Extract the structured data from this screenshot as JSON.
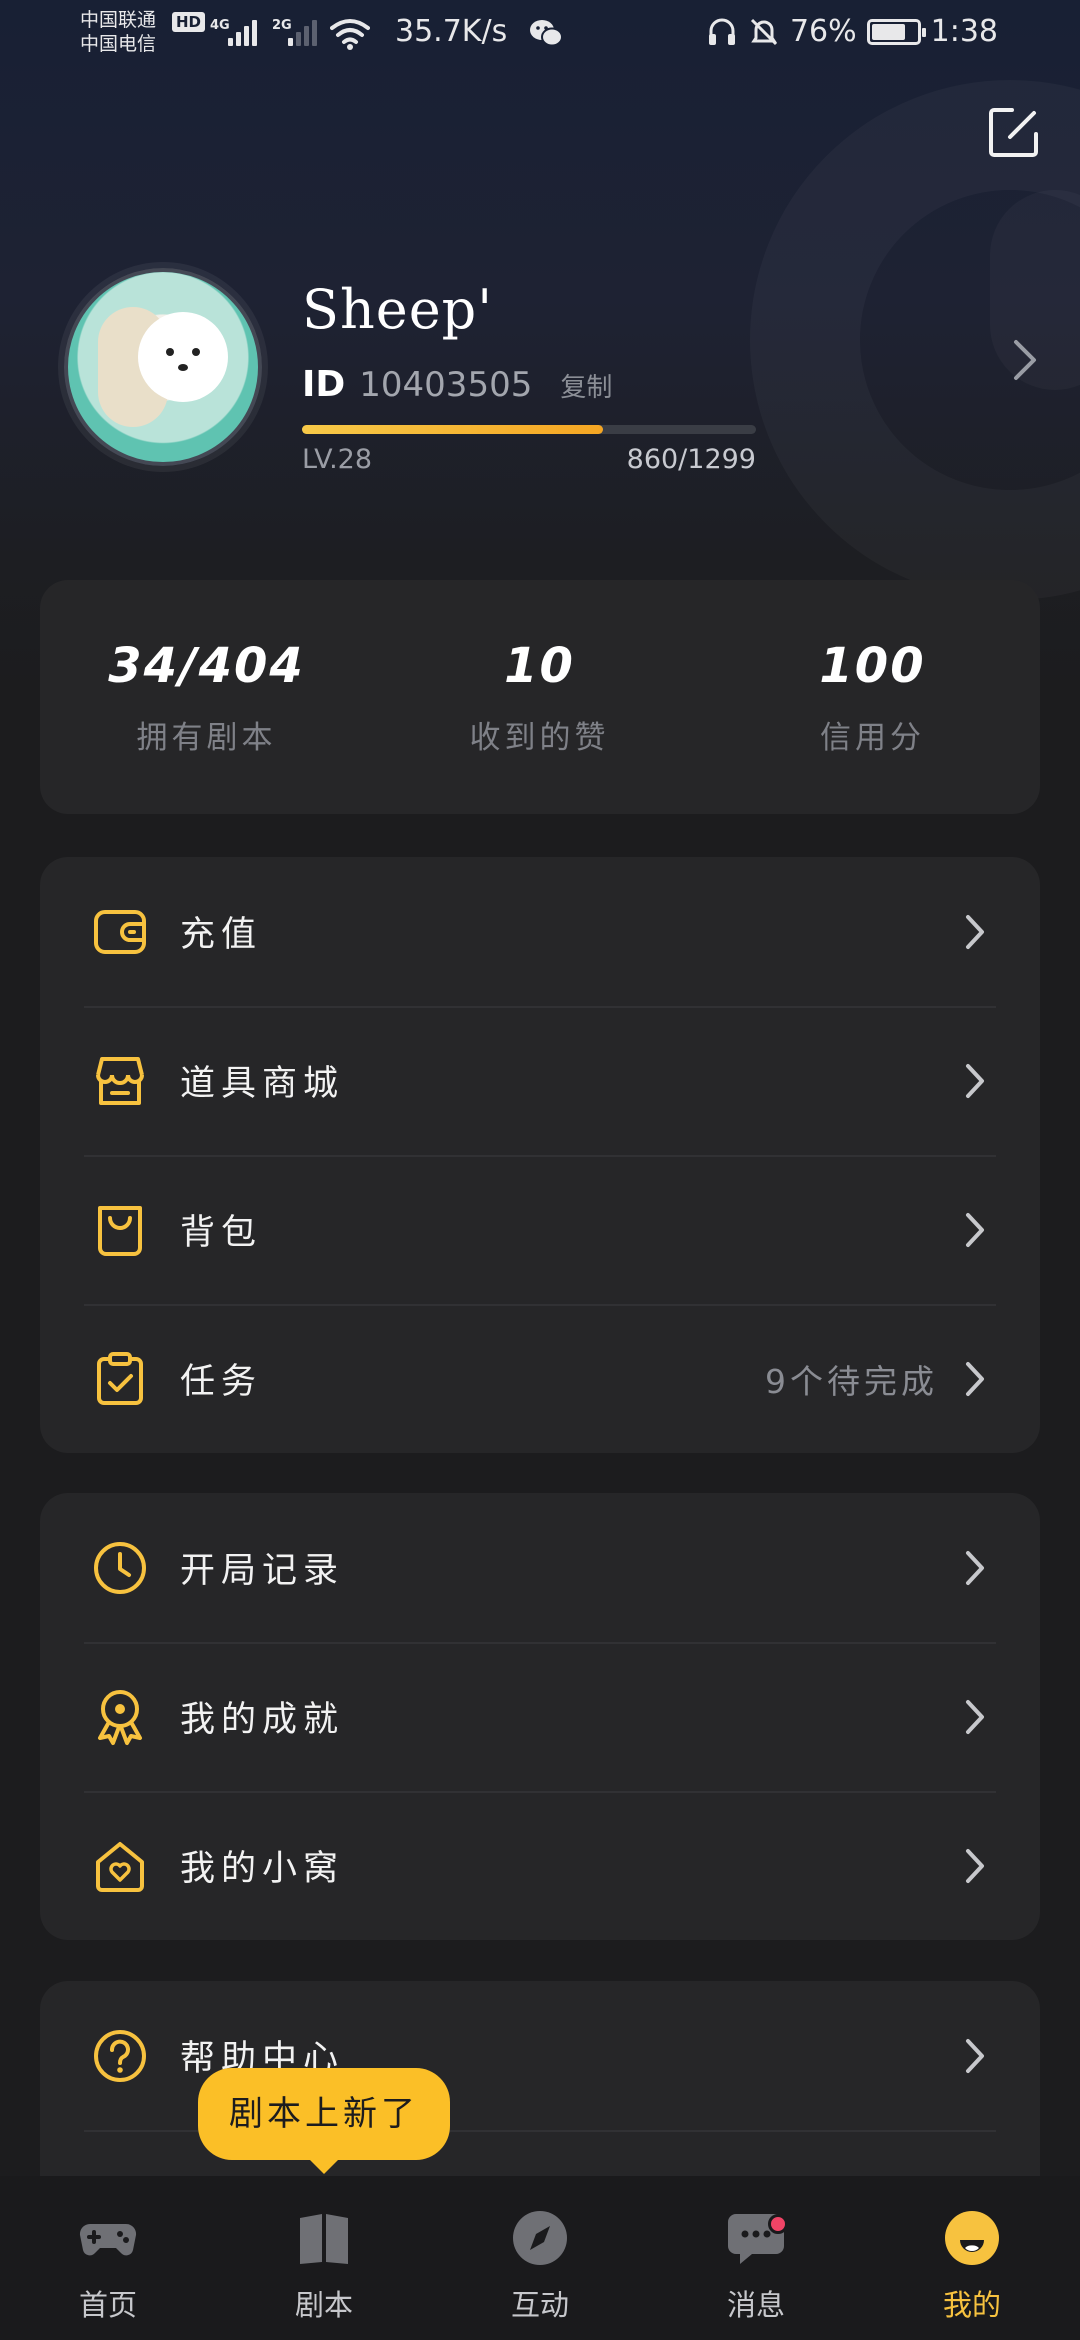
{
  "status_bar": {
    "carrier_1": "中国联通",
    "carrier_2": "中国电信",
    "hd": "HD",
    "net_1": "4G",
    "net_2": "2G",
    "speed": "35.7K/s",
    "battery_percent": "76%",
    "battery_level": 0.76,
    "time": "1:38"
  },
  "profile": {
    "username": "Sheep'",
    "id_label": "ID",
    "id_value": "10403505",
    "copy_label": "复制",
    "level": "LV.28",
    "exp": "860/1299",
    "exp_current": 860,
    "exp_total": 1299
  },
  "stats": [
    {
      "value": "34/404",
      "label": "拥有剧本"
    },
    {
      "value": "10",
      "label": "收到的赞"
    },
    {
      "value": "100",
      "label": "信用分"
    }
  ],
  "menu_group_1": [
    {
      "label": "充值",
      "icon": "wallet-icon"
    },
    {
      "label": "道具商城",
      "icon": "shop-icon"
    },
    {
      "label": "背包",
      "icon": "bag-icon"
    },
    {
      "label": "任务",
      "icon": "clipboard-check-icon",
      "extra": "9个待完成"
    }
  ],
  "menu_group_2": [
    {
      "label": "开局记录",
      "icon": "clock-icon"
    },
    {
      "label": "我的成就",
      "icon": "medal-icon"
    },
    {
      "label": "我的小窝",
      "icon": "home-heart-icon"
    }
  ],
  "menu_group_3": [
    {
      "label": "帮助中心",
      "icon": "help-icon"
    }
  ],
  "tooltip": "剧本上新了",
  "tabs": [
    {
      "label": "首页",
      "icon": "gamepad-icon"
    },
    {
      "label": "剧本",
      "icon": "book-icon"
    },
    {
      "label": "互动",
      "icon": "compass-icon"
    },
    {
      "label": "消息",
      "icon": "chat-icon"
    },
    {
      "label": "我的",
      "icon": "smile-face-icon"
    }
  ],
  "colors": {
    "accent": "#f7c23f",
    "badge": "#f04466",
    "card": "#262628",
    "background": "#1c1c1e"
  }
}
